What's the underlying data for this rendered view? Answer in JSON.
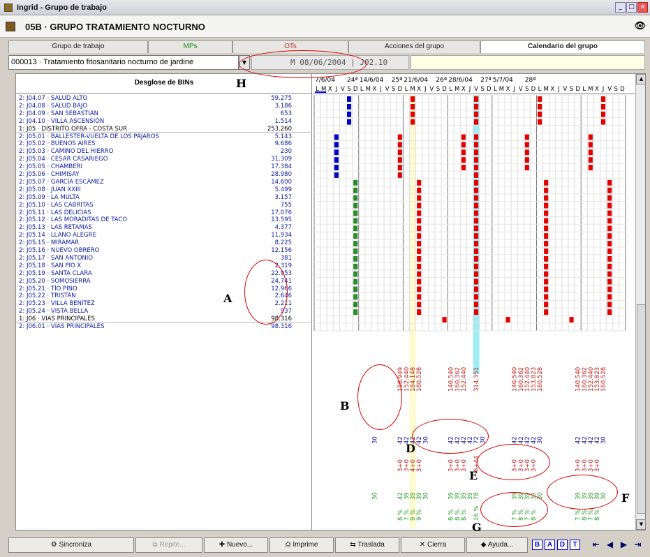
{
  "window": {
    "title": "Ingrid - Grupo de trabajo",
    "minimize": "_",
    "restore": "□",
    "close": "×"
  },
  "header": {
    "title": "05B · GRUPO TRATAMIENTO NOCTURNO",
    "search_icon": "binoculars-icon"
  },
  "tabs": [
    {
      "label": "Grupo de trabajo",
      "color": "#222"
    },
    {
      "label": "MPs",
      "color": "#1a8a1a"
    },
    {
      "label": "OTs",
      "color": "#c03030"
    },
    {
      "label": "Acciones del grupo",
      "color": "#222"
    },
    {
      "label": "Calendario del grupo",
      "color": "#111",
      "active": true
    }
  ],
  "toolbar": {
    "combo_value": "000013 · Tratamiento fitosanitario nocturno de jardine",
    "date_value": "M  08/06/2004 | J02.10"
  },
  "grid": {
    "column_header": "Desglose de BINs",
    "rows": [
      {
        "name": "2: J04.07 · SALUD ALTO",
        "value": "59.275",
        "type": "sub"
      },
      {
        "name": "2: J04.08 · SALUD BAJO",
        "value": "3.186",
        "type": "sub"
      },
      {
        "name": "2: J04.09 · SAN SEBASTIÁN",
        "value": "653",
        "type": "sub"
      },
      {
        "name": "2: J04.10 · VILLA ASCENSIÓN",
        "value": "1.514",
        "type": "sub"
      },
      {
        "name": "1: J05 · DISTRITO OFRA - COSTA SUR",
        "value": "253.260",
        "type": "grp"
      },
      {
        "name": "2: J05.01 · BALLESTER-VUELTA DE LOS PÁJAROS",
        "value": "5.143",
        "type": "sub"
      },
      {
        "name": "2: J05.02 · BUENOS AIRES",
        "value": "9.686",
        "type": "sub"
      },
      {
        "name": "2: J05.03 · CAMINO DEL HIERRO",
        "value": "230",
        "type": "sub"
      },
      {
        "name": "2: J05.04 · CESAR CASARIEGO",
        "value": "31.309",
        "type": "sub"
      },
      {
        "name": "2: J05.05 · CHAMBERI",
        "value": "17.384",
        "type": "sub"
      },
      {
        "name": "2: J05.06 · CHIMISAY",
        "value": "28.980",
        "type": "sub"
      },
      {
        "name": "2: J05.07 · GARCÍA ESCÁMEZ",
        "value": "14.600",
        "type": "sub"
      },
      {
        "name": "2: J05.08 · JUAN XXIII",
        "value": "5.499",
        "type": "sub"
      },
      {
        "name": "2: J05.09 · LA MULTA",
        "value": "3.157",
        "type": "sub"
      },
      {
        "name": "2: J05.10 · LAS CABRITAS",
        "value": "755",
        "type": "sub"
      },
      {
        "name": "2: J05.11 · LAS DELICIAS",
        "value": "17.076",
        "type": "sub"
      },
      {
        "name": "2: J05.12 · LAS MORADITAS DE TACO",
        "value": "13.595",
        "type": "sub"
      },
      {
        "name": "2: J05.13 · LAS RETAMAS",
        "value": "4.377",
        "type": "sub"
      },
      {
        "name": "2: J05.14 · LLANO ALEGRE",
        "value": "11.934",
        "type": "sub"
      },
      {
        "name": "2: J05.15 · MIRAMAR",
        "value": "8.225",
        "type": "sub"
      },
      {
        "name": "2: J05.16 · NUEVO OBRERO",
        "value": "12.156",
        "type": "sub"
      },
      {
        "name": "2: J05.17 · SAN ANTONIO",
        "value": "381",
        "type": "sub"
      },
      {
        "name": "2: J05.18 · SAN PÍO X",
        "value": "2.319",
        "type": "sub"
      },
      {
        "name": "2: J05.19 · SANTA CLARA",
        "value": "22.953",
        "type": "sub"
      },
      {
        "name": "2: J05.20 · SOMOSIERRA",
        "value": "24.741",
        "type": "sub"
      },
      {
        "name": "2: J05.21 · TÍO PINO",
        "value": "12.966",
        "type": "sub"
      },
      {
        "name": "2: J05.22 · TRISTÁN",
        "value": "2.646",
        "type": "sub"
      },
      {
        "name": "2: J05.23 · VILLA BENÍTEZ",
        "value": "2.211",
        "type": "sub"
      },
      {
        "name": "2: J05.24 · VISTA BELLA",
        "value": "937",
        "type": "sub"
      },
      {
        "name": "1: J06 · VIAS PRINCIPALES",
        "value": "98.316",
        "type": "grp"
      },
      {
        "name": "2: J06.01 · VÍAS PRINCIPALES",
        "value": "98.316",
        "type": "sub"
      }
    ]
  },
  "calendar": {
    "week_headers": [
      {
        "date": "7/6/04",
        "week": "24ª"
      },
      {
        "date": "14/6/04",
        "week": "25ª"
      },
      {
        "date": "21/6/04",
        "week": "26ª"
      },
      {
        "date": "28/6/04",
        "week": "27ª"
      },
      {
        "date": "5/7/04",
        "week": "28ª"
      }
    ],
    "day_letters": [
      "L",
      "M",
      "X",
      "J",
      "V",
      "S",
      "D"
    ],
    "sum_row1": [
      {
        "d": 13,
        "v": "158.949"
      },
      {
        "d": 14,
        "v": "152.440"
      },
      {
        "d": 15,
        "v": "184.148"
      },
      {
        "d": 16,
        "v": "160.528"
      },
      {
        "d": 21,
        "v": "140.540"
      },
      {
        "d": 22,
        "v": "160.362"
      },
      {
        "d": 23,
        "v": "152.440"
      },
      {
        "d": 25,
        "v": "314.351"
      },
      {
        "d": 31,
        "v": "140.540"
      },
      {
        "d": 32,
        "v": "160.362"
      },
      {
        "d": 33,
        "v": "152.440"
      },
      {
        "d": 34,
        "v": "153.823"
      },
      {
        "d": 35,
        "v": "160.528"
      },
      {
        "d": 41,
        "v": "140.540"
      },
      {
        "d": 42,
        "v": "160.362"
      },
      {
        "d": 43,
        "v": "152.440"
      },
      {
        "d": 44,
        "v": "153.823"
      },
      {
        "d": 45,
        "v": "160.528"
      }
    ],
    "sum_row2": [
      {
        "d": 9,
        "v": "30"
      },
      {
        "d": 13,
        "v": "42"
      },
      {
        "d": 14,
        "v": "42"
      },
      {
        "d": 15,
        "v": "42"
      },
      {
        "d": 16,
        "v": "42"
      },
      {
        "d": 17,
        "v": "30"
      },
      {
        "d": 21,
        "v": "42"
      },
      {
        "d": 22,
        "v": "42"
      },
      {
        "d": 23,
        "v": "42"
      },
      {
        "d": 24,
        "v": "42"
      },
      {
        "d": 25,
        "v": "72"
      },
      {
        "d": 26,
        "v": "30"
      },
      {
        "d": 31,
        "v": "42"
      },
      {
        "d": 32,
        "v": "42"
      },
      {
        "d": 33,
        "v": "42"
      },
      {
        "d": 34,
        "v": "42"
      },
      {
        "d": 35,
        "v": "30"
      },
      {
        "d": 41,
        "v": "42"
      },
      {
        "d": 42,
        "v": "42"
      },
      {
        "d": 43,
        "v": "42"
      },
      {
        "d": 44,
        "v": "42"
      },
      {
        "d": 45,
        "v": "30"
      }
    ],
    "sum_row3": [
      {
        "d": 13,
        "v": "3+0"
      },
      {
        "d": 14,
        "v": "3+0"
      },
      {
        "d": 15,
        "v": "4+0"
      },
      {
        "d": 16,
        "v": "3+0"
      },
      {
        "d": 21,
        "v": "3+0"
      },
      {
        "d": 22,
        "v": "3+0"
      },
      {
        "d": 23,
        "v": "3+0"
      },
      {
        "d": 25,
        "v": "6+44"
      },
      {
        "d": 31,
        "v": "3+0"
      },
      {
        "d": 32,
        "v": "3+0"
      },
      {
        "d": 33,
        "v": "3+0"
      },
      {
        "d": 34,
        "v": "3+0"
      },
      {
        "d": 41,
        "v": "3+0"
      },
      {
        "d": 42,
        "v": "3+0"
      },
      {
        "d": 43,
        "v": "3+0"
      },
      {
        "d": 44,
        "v": "3+0"
      }
    ],
    "sum_row4": [
      {
        "d": 9,
        "v": "30"
      },
      {
        "d": 13,
        "v": "42"
      },
      {
        "d": 14,
        "v": "39"
      },
      {
        "d": 15,
        "v": "39"
      },
      {
        "d": 16,
        "v": "39"
      },
      {
        "d": 17,
        "v": "30"
      },
      {
        "d": 21,
        "v": "39"
      },
      {
        "d": 22,
        "v": "39"
      },
      {
        "d": 23,
        "v": "39"
      },
      {
        "d": 24,
        "v": "39"
      },
      {
        "d": 25,
        "v": "78"
      },
      {
        "d": 31,
        "v": "39"
      },
      {
        "d": 32,
        "v": "39"
      },
      {
        "d": 33,
        "v": "39"
      },
      {
        "d": 34,
        "v": "39"
      },
      {
        "d": 35,
        "v": "30"
      },
      {
        "d": 41,
        "v": "39"
      },
      {
        "d": 42,
        "v": "39"
      },
      {
        "d": 43,
        "v": "39"
      },
      {
        "d": 44,
        "v": "39"
      },
      {
        "d": 45,
        "v": "30"
      }
    ],
    "sum_row5": [
      {
        "d": 13,
        "v": "8 %"
      },
      {
        "d": 14,
        "v": "7 %"
      },
      {
        "d": 15,
        "v": "9 %"
      },
      {
        "d": 16,
        "v": "9 %"
      },
      {
        "d": 21,
        "v": "8 %"
      },
      {
        "d": 22,
        "v": "8 %"
      },
      {
        "d": 23,
        "v": "8 %"
      },
      {
        "d": 25,
        "v": "16 %"
      },
      {
        "d": 31,
        "v": "7 %"
      },
      {
        "d": 32,
        "v": "8 %"
      },
      {
        "d": 33,
        "v": "7 %"
      },
      {
        "d": 34,
        "v": "8 %"
      },
      {
        "d": 41,
        "v": "7 %"
      },
      {
        "d": 42,
        "v": "8 %"
      },
      {
        "d": 43,
        "v": "7 %"
      },
      {
        "d": 44,
        "v": "8 %"
      }
    ],
    "colors": {
      "marker_red": "#e00000",
      "marker_blue": "#0000c0",
      "marker_green": "#2a8a2a",
      "today_yellow": "#fffbd0",
      "highlight_cyan": "#a0ecf4",
      "sum_red": "#c02020",
      "sum_blue": "#1a1aa0",
      "sum_green": "#2aa02a"
    }
  },
  "annotations": [
    "A",
    "B",
    "D",
    "E",
    "F",
    "G",
    "H"
  ],
  "bottom": {
    "sync": "Sincroniza",
    "repeat": "Repite...",
    "new": "Nuevo...",
    "print": "Imprime",
    "move": "Traslada",
    "close": "Cierra",
    "help": "Ayuda...",
    "b": "B",
    "a": "A",
    "d": "D",
    "t": "T"
  }
}
